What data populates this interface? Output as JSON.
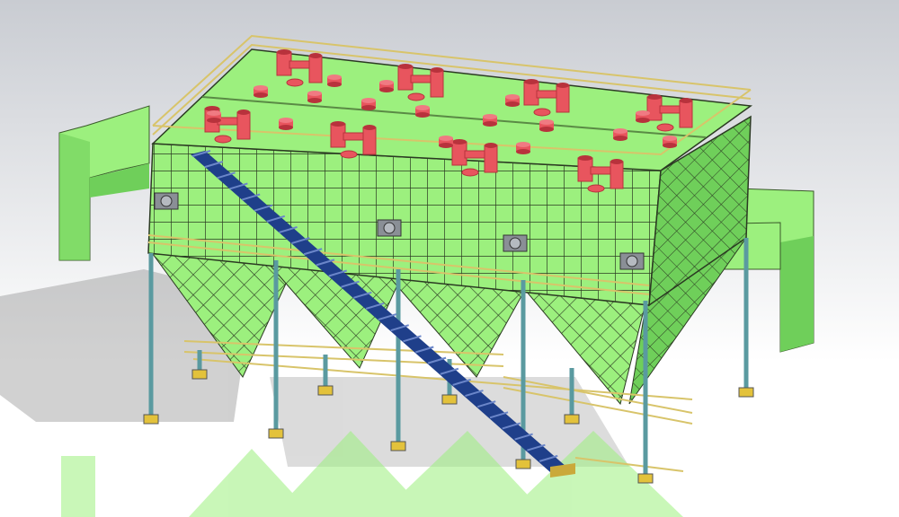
{
  "scene": {
    "subject": "cad-model-baghouse-dust-collector",
    "view": "isometric",
    "counts": {
      "hoppers": 4,
      "support_columns": 10,
      "roof_valve_assemblies": 8,
      "staircases": 1,
      "side_ducts": 2
    },
    "colors": {
      "background_top": "#c9ccd2",
      "background_bottom": "#ffffff",
      "body_green": "#9cf07e",
      "body_green_dark": "#6fcf5a",
      "grid_line": "#2b3a22",
      "valve_red": "#e8555e",
      "valve_red_dark": "#b8323c",
      "stair_blue": "#1f3f8a",
      "railing_yellow": "#d8c46a",
      "column_teal": "#5a9aa0",
      "footing_yellow": "#e3c23b"
    },
    "icons": [
      "valve-icon",
      "motor-icon"
    ]
  }
}
